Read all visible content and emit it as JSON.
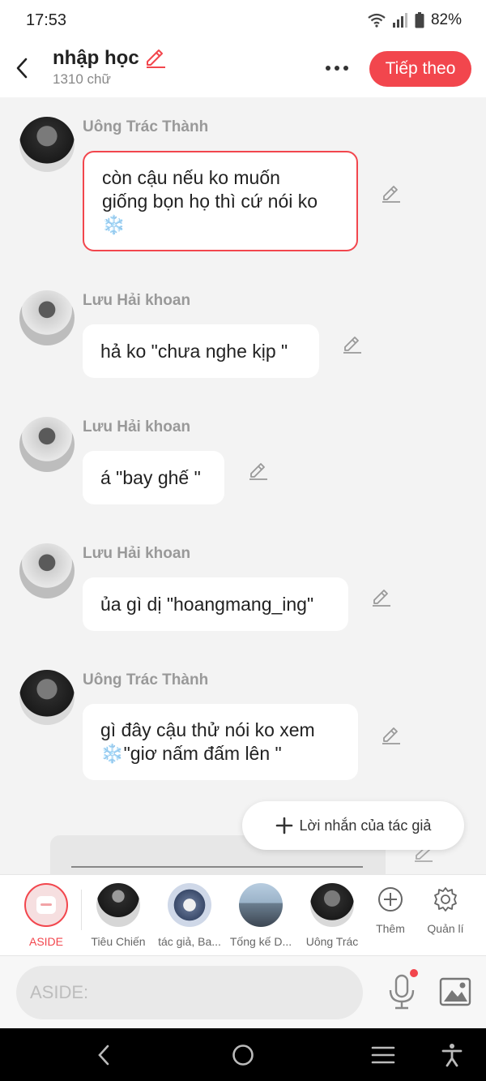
{
  "status_bar": {
    "time": "17:53",
    "battery": "82%"
  },
  "header": {
    "title": "nhập học",
    "subtitle": "1310 chữ",
    "next_label": "Tiếp theo"
  },
  "messages": [
    {
      "sender": "Uông Trác Thành",
      "avatar": "dark",
      "lines": [
        "còn cậu nếu ko muốn",
        "giống bọn họ thì cứ nói ko",
        "❄️"
      ],
      "selected": true
    },
    {
      "sender": "Lưu Hải khoan",
      "avatar": "light",
      "lines": [
        "hả ko \"chưa nghe kịp \""
      ],
      "selected": false
    },
    {
      "sender": "Lưu Hải khoan",
      "avatar": "light",
      "lines": [
        "á \"bay ghế \""
      ],
      "selected": false
    },
    {
      "sender": "Lưu Hải khoan",
      "avatar": "light",
      "lines": [
        "ủa gì dị \"hoangmang_ing\""
      ],
      "selected": false
    },
    {
      "sender": "Uông Trác Thành",
      "avatar": "dark",
      "lines": [
        "gì đây cậu thử nói ko xem",
        "❄️\"giơ nấm đấm lên \""
      ],
      "selected": false
    }
  ],
  "author_note": {
    "label": "Lời nhắn của tác giả"
  },
  "characters": {
    "aside_label": "ASIDE",
    "items": [
      {
        "name": "Tiêu Chiến"
      },
      {
        "name": "tác giả, Ba..."
      },
      {
        "name": "Tống kế D..."
      },
      {
        "name": "Uông Trác"
      }
    ],
    "add_label": "Thêm",
    "manage_label": "Quản lí"
  },
  "input": {
    "placeholder": "ASIDE:"
  },
  "icons": {
    "back": "chevron-left-icon",
    "edit": "pencil-icon",
    "more": "more-horizontal-icon",
    "plus": "plus-icon",
    "add": "plus-circle-icon",
    "manage": "gear-icon",
    "mic": "microphone-icon",
    "image": "image-icon"
  },
  "colors": {
    "accent": "#f2464d",
    "background": "#f3f3f3",
    "bubble": "#ffffff"
  }
}
